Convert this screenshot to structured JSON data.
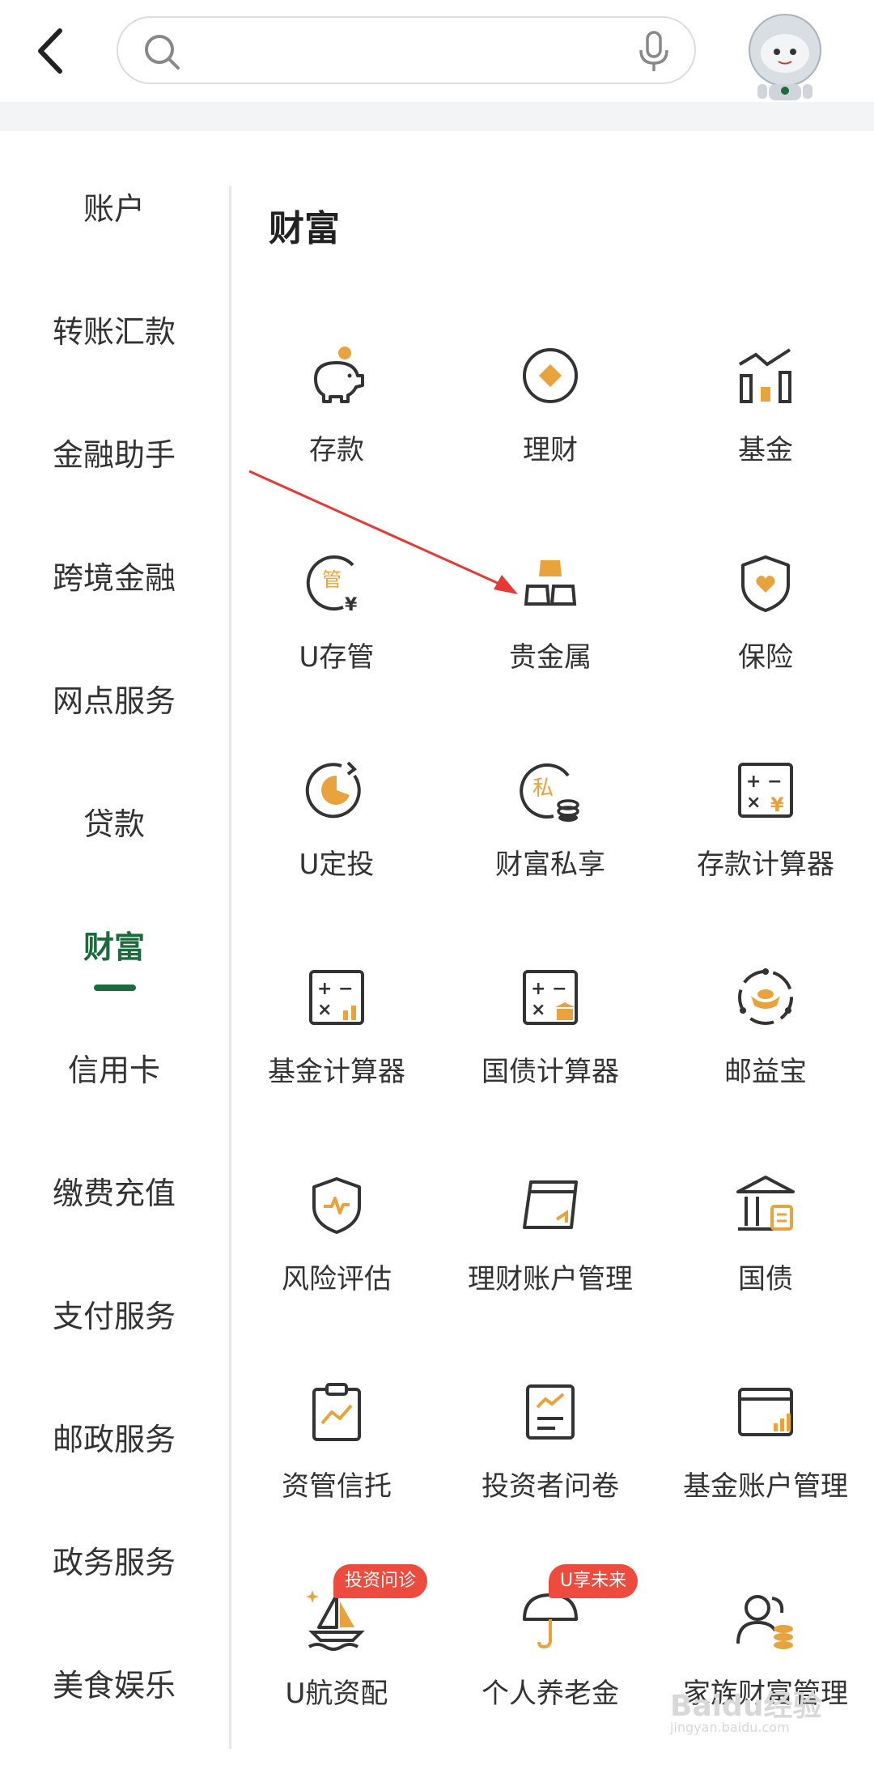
{
  "header": {
    "back_icon": "chevron-left-icon",
    "search_placeholder": "",
    "search_icon": "search-icon",
    "mic_icon": "microphone-icon",
    "avatar_icon": "robot-avatar-icon"
  },
  "sidebar": {
    "items": [
      {
        "label": "账户"
      },
      {
        "label": "转账汇款"
      },
      {
        "label": "金融助手"
      },
      {
        "label": "跨境金融"
      },
      {
        "label": "网点服务"
      },
      {
        "label": "贷款"
      },
      {
        "label": "财富",
        "active": true
      },
      {
        "label": "信用卡"
      },
      {
        "label": "缴费充值"
      },
      {
        "label": "支付服务"
      },
      {
        "label": "邮政服务"
      },
      {
        "label": "政务服务"
      },
      {
        "label": "美食娱乐"
      }
    ]
  },
  "main": {
    "title": "财富",
    "grid": [
      {
        "label": "存款",
        "icon": "piggy-bank-icon"
      },
      {
        "label": "理财",
        "icon": "wealth-diamond-icon"
      },
      {
        "label": "基金",
        "icon": "fund-chart-icon"
      },
      {
        "label": "U存管",
        "icon": "custody-icon"
      },
      {
        "label": "贵金属",
        "icon": "gold-bars-icon"
      },
      {
        "label": "保险",
        "icon": "shield-heart-icon"
      },
      {
        "label": "U定投",
        "icon": "fixed-investment-icon"
      },
      {
        "label": "财富私享",
        "icon": "private-wealth-icon"
      },
      {
        "label": "存款计算器",
        "icon": "deposit-calculator-icon"
      },
      {
        "label": "基金计算器",
        "icon": "fund-calculator-icon"
      },
      {
        "label": "国债计算器",
        "icon": "bond-calculator-icon"
      },
      {
        "label": "邮益宝",
        "icon": "ingot-cycle-icon"
      },
      {
        "label": "风险评估",
        "icon": "risk-shield-icon"
      },
      {
        "label": "理财账户管理",
        "icon": "wealth-account-icon"
      },
      {
        "label": "国债",
        "icon": "bank-building-icon"
      },
      {
        "label": "资管信托",
        "icon": "clipboard-trend-icon"
      },
      {
        "label": "投资者问卷",
        "icon": "questionnaire-icon"
      },
      {
        "label": "基金账户管理",
        "icon": "fund-account-icon"
      },
      {
        "label": "U航资配",
        "icon": "sailboat-icon",
        "badge": "投资问诊"
      },
      {
        "label": "个人养老金",
        "icon": "umbrella-icon",
        "badge": "U享未来"
      },
      {
        "label": "家族财富管理",
        "icon": "family-wealth-icon"
      }
    ]
  },
  "colors": {
    "accent": "#1b6b3c",
    "icon_orange": "#e8a33d",
    "badge_red": "#ec4b3e",
    "arrow_red": "#e53935"
  },
  "watermark": {
    "brand": "Baidu经验",
    "url": "jingyan.baidu.com"
  }
}
